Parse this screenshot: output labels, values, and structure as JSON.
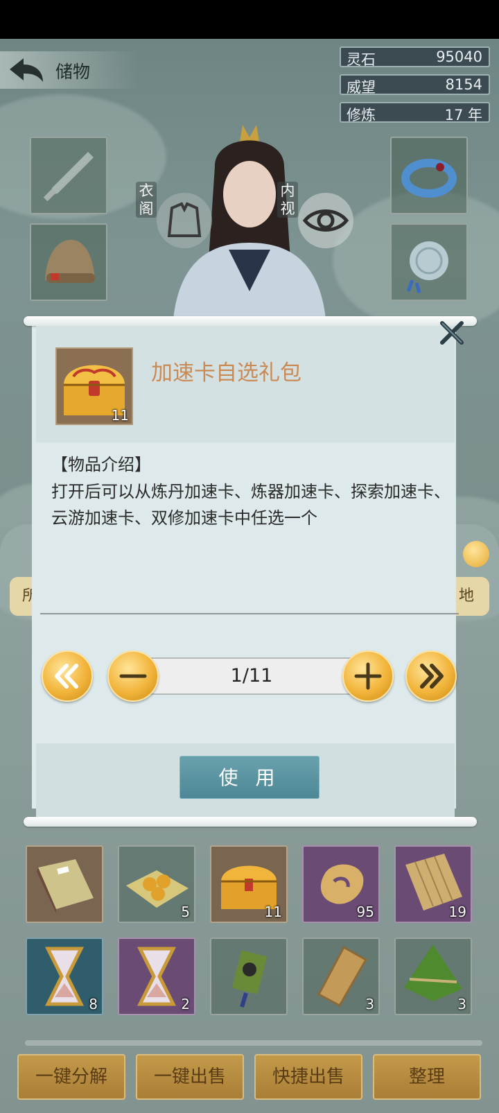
{
  "header": {
    "title": "储物"
  },
  "stats": [
    {
      "label": "灵石",
      "value": "95040"
    },
    {
      "label": "威望",
      "value": "8154"
    },
    {
      "label": "修炼",
      "value": "17 年"
    }
  ],
  "character": {
    "left_label": "衣\n阁",
    "right_label": "内\n视"
  },
  "side_tab_left": "所",
  "side_tab_right": "地",
  "dialog": {
    "item_name": "加速卡自选礼包",
    "item_count": "11",
    "section_title": "【物品介绍】",
    "description": "打开后可以从炼丹加速卡、炼器加速卡、探索加速卡、云游加速卡、双修加速卡中任选一个",
    "quantity": "1/11",
    "use_label": "使 用"
  },
  "inventory": {
    "row1": [
      {
        "icon": "book-icon",
        "count": ""
      },
      {
        "icon": "pills-icon",
        "count": "5"
      },
      {
        "icon": "treasure-chest-icon",
        "count": "11"
      },
      {
        "icon": "jade-pendant-icon",
        "count": "95"
      },
      {
        "icon": "scroll-icon",
        "count": "19"
      }
    ],
    "row2": [
      {
        "icon": "hourglass-icon",
        "count": "8"
      },
      {
        "icon": "hourglass-icon",
        "count": "2"
      },
      {
        "icon": "portrait-charm-icon",
        "count": ""
      },
      {
        "icon": "token-icon",
        "count": "3"
      },
      {
        "icon": "zongzi-icon",
        "count": "3"
      }
    ]
  },
  "bottom_buttons": [
    "一键分解",
    "一键出售",
    "快捷出售",
    "整理"
  ]
}
